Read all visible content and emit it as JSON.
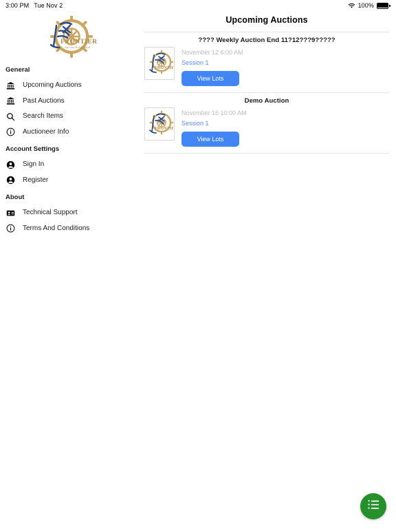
{
  "statusbar": {
    "time": "3:00 PM",
    "date": "Tue Nov 2",
    "battery_percent": "100%",
    "wifi_icon": "wifi-icon",
    "battery_icon": "battery-full-icon"
  },
  "brand": {
    "logo_text": "FRONTIER",
    "logo_sub": "Auction & Appraisal",
    "logo_icon": "ships-wheel-logo"
  },
  "sidebar": {
    "sections": [
      {
        "heading": "General",
        "items": [
          {
            "label": "Upcoming Auctions",
            "icon": "bank-icon"
          },
          {
            "label": "Past Auctions",
            "icon": "bank-icon"
          },
          {
            "label": "Search Items",
            "icon": "search-icon"
          },
          {
            "label": "Auctioneer Info",
            "icon": "info-circle-icon"
          }
        ]
      },
      {
        "heading": "Account Settings",
        "items": [
          {
            "label": "Sign In",
            "icon": "person-icon"
          },
          {
            "label": "Register",
            "icon": "person-icon"
          }
        ]
      },
      {
        "heading": "About",
        "items": [
          {
            "label": "Technical Support",
            "icon": "contact-card-icon"
          },
          {
            "label": "Terms And Conditions",
            "icon": "info-circle-icon"
          }
        ]
      }
    ]
  },
  "main": {
    "title": "Upcoming Auctions",
    "auctions": [
      {
        "title": "???? Weekly Auction End 11?12???9?????",
        "date": "November 12 6:00 AM",
        "session": "Session 1",
        "button_label": "View Lots",
        "thumb_icon": "auction-logo-thumbnail"
      },
      {
        "title": "Demo Auction",
        "date": "November 16 10:00 AM",
        "session": "Session 1",
        "button_label": "View Lots",
        "thumb_icon": "auction-logo-thumbnail"
      }
    ]
  },
  "fab": {
    "icon": "list-icon",
    "color": "#26912b"
  },
  "colors": {
    "accent_blue": "#4285f4",
    "session_blue": "#5b8def",
    "date_grey": "#bdbdc2",
    "divider": "#e4e4e6",
    "fab_green": "#26912b"
  }
}
